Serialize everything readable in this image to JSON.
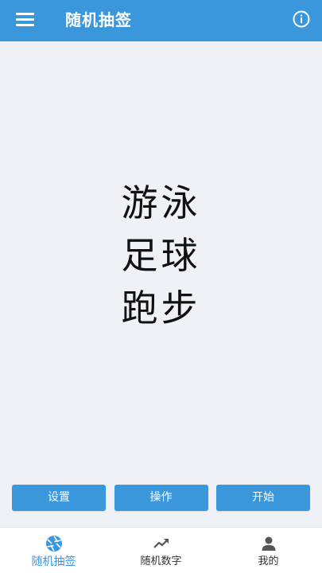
{
  "header": {
    "title": "随机抽签",
    "menu_icon": "menu-icon",
    "info_icon": "info-icon",
    "color": "#3b97dc"
  },
  "results": [
    "游泳",
    "足球",
    "跑步"
  ],
  "actions": {
    "settings_label": "设置",
    "operate_label": "操作",
    "start_label": "开始"
  },
  "bottom_nav": {
    "items": [
      {
        "label": "随机抽签",
        "icon": "aperture-icon",
        "active": true
      },
      {
        "label": "随机数字",
        "icon": "trend-icon",
        "active": false
      },
      {
        "label": "我的",
        "icon": "person-icon",
        "active": false
      }
    ]
  },
  "colors": {
    "accent": "#3b97dc",
    "background": "#eef2f7",
    "inactive_icon": "#555555"
  }
}
